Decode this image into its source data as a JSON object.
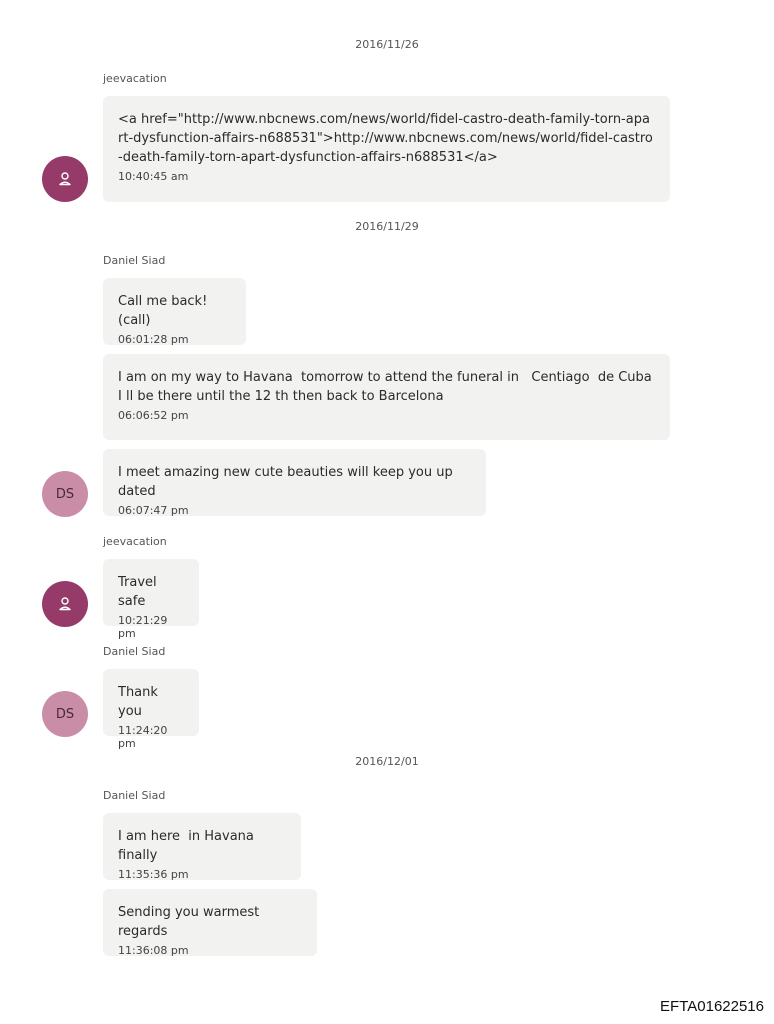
{
  "colors": {
    "avatar_jeevacation": "#963a69",
    "avatar_ds": "#c98da8",
    "bubble_bg": "#f2f2f0"
  },
  "dates": [
    "2016/11/26",
    "2016/11/29",
    "2016/12/01"
  ],
  "senders": {
    "jeevacation": "jeevacation",
    "daniel": "Daniel Siad"
  },
  "avatars": {
    "ds_initials": "DS",
    "jeevacation_icon": "person-icon"
  },
  "messages": [
    {
      "text": "<a href=\"http://www.nbcnews.com/news/world/fidel-castro-death-family-torn-apart-dysfunction-affairs-n688531\">http://www.nbcnews.com/news/world/fidel-castro-death-family-torn-apart-dysfunction-affairs-n688531</a>",
      "time": "10:40:45 am"
    },
    {
      "text": "Call me back! (call)",
      "time": "06:01:28 pm"
    },
    {
      "text": "I am on my way to Havana  tomorrow to attend the funeral in   Centiago  de Cuba I ll be there until the 12 th then back to Barcelona",
      "time": "06:06:52 pm"
    },
    {
      "text": "I meet amazing new cute beauties will keep you up dated",
      "time": "06:07:47 pm"
    },
    {
      "text": "Travel safe",
      "time": "10:21:29 pm"
    },
    {
      "text": "Thank you",
      "time": "11:24:20 pm"
    },
    {
      "text": "I am here  in Havana finally",
      "time": "11:35:36 pm"
    },
    {
      "text": "Sending you warmest regards",
      "time": "11:36:08 pm"
    }
  ],
  "footer": {
    "doc_id": "EFTA01622516"
  }
}
